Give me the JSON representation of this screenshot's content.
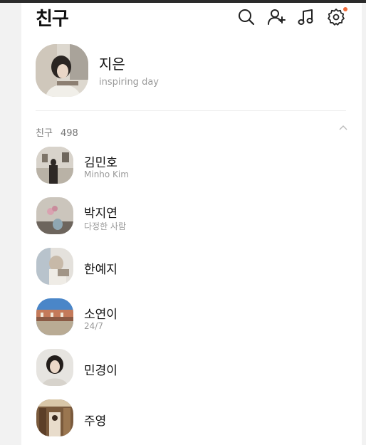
{
  "header": {
    "title": "친구",
    "icons": [
      "search-icon",
      "add-friend-icon",
      "music-icon",
      "settings-icon"
    ],
    "settings_badge_color": "#f26b3a"
  },
  "me": {
    "name": "지은",
    "status": "inspiring day"
  },
  "friends_section": {
    "label": "친구",
    "count": "498"
  },
  "friends": [
    {
      "name": "김민호",
      "status": "Minho Kim"
    },
    {
      "name": "박지연",
      "status": "다정한 사람"
    },
    {
      "name": "한예지",
      "status": ""
    },
    {
      "name": "소연이",
      "status": "24/7"
    },
    {
      "name": "민경이",
      "status": ""
    },
    {
      "name": "주영",
      "status": ""
    }
  ]
}
